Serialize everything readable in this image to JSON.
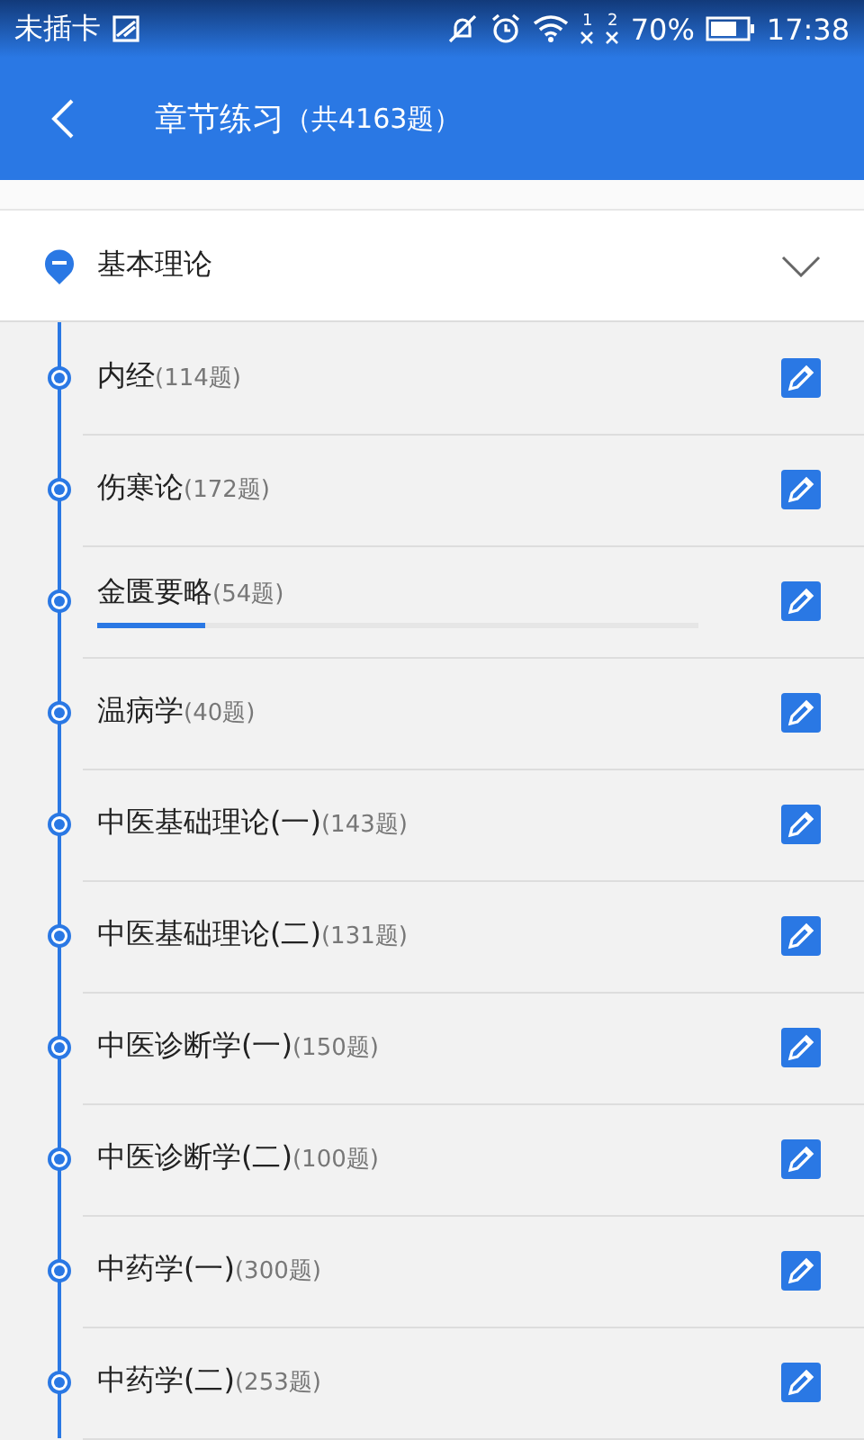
{
  "status_bar": {
    "carrier": "未插卡",
    "battery_text": "70%",
    "time": "17:38",
    "sim1": "1",
    "sim2": "2"
  },
  "header": {
    "title": "章节练习",
    "count": "（共4163题）"
  },
  "section": {
    "title": "基本理论",
    "expanded": true,
    "items": [
      {
        "name": "内经",
        "count": "(114题)"
      },
      {
        "name": "伤寒论",
        "count": "(172题)"
      },
      {
        "name": "金匮要略",
        "count": "(54题)",
        "level": 0.18
      },
      {
        "name": "温病学",
        "count": "(40题)"
      },
      {
        "name": "中医基础理论(一)",
        "count": "(143题)"
      },
      {
        "name": "中医基础理论(二)",
        "count": "(131题)"
      },
      {
        "name": "中医诊断学(一)",
        "count": "(150题)"
      },
      {
        "name": "中医诊断学(二)",
        "count": "(100题)"
      },
      {
        "name": "中药学(一)",
        "count": "(300题)"
      },
      {
        "name": "中药学(二)",
        "count": "(253题)"
      }
    ]
  }
}
